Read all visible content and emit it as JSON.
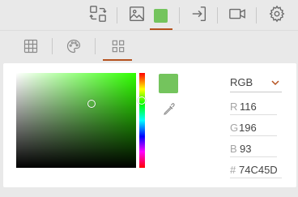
{
  "icons": {
    "swap": "swap-arrows-icon",
    "image": "image-icon",
    "color_swatch": "color-swatch-icon",
    "login": "login-icon",
    "video": "video-camera-icon",
    "settings": "gear-icon",
    "grid": "grid-icon",
    "palette": "palette-icon",
    "apps": "apps-grid-icon",
    "eyedropper": "eyedropper-icon",
    "dropdown": "chevron-down-icon"
  },
  "colors": {
    "accent": "#b5521f",
    "current": "#74c45d",
    "pure_hue": "#2fff00"
  },
  "color_picker": {
    "mode": "RGB",
    "r_label": "R",
    "r_value": "116",
    "g_label": "G",
    "g_value": "196",
    "b_label": "B",
    "b_value": "93",
    "hex_label": "#",
    "hex_value": "74C45D"
  }
}
